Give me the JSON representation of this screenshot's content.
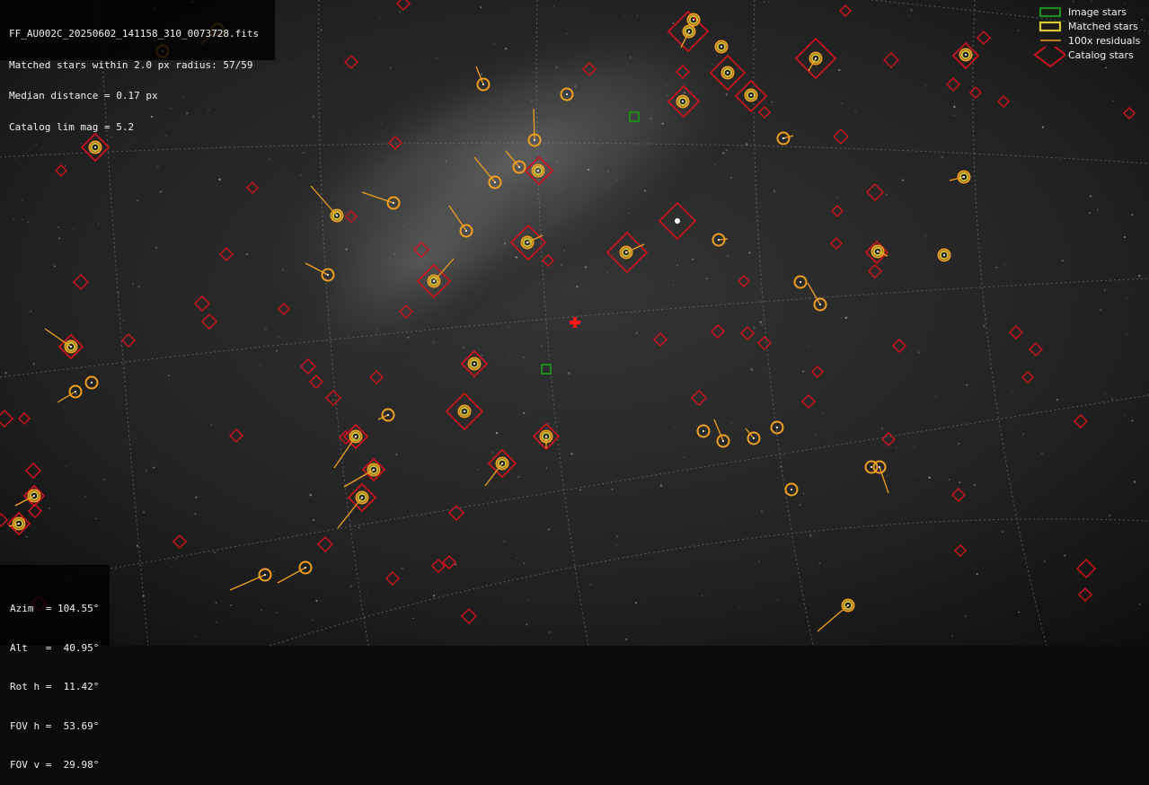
{
  "info": {
    "filename": "FF_AU002C_20250602_141158_310_0073728.fits",
    "matched": "Matched stars within 2.0 px radius: 57/59",
    "median": "Median distance = 0.17 px",
    "limmag": "Catalog lim mag = 5.2"
  },
  "orientation": {
    "azim": "Azim  = 104.55°",
    "alt": "Alt   =  40.95°",
    "roth": "Rot h =  11.42°",
    "fovh": "FOV h =  53.69°",
    "fovv": "FOV v =  29.98°"
  },
  "legend": {
    "image_stars": "Image stars",
    "matched_stars": "Matched stars",
    "residuals": "100x residuals",
    "catalog_stars": "Catalog stars"
  },
  "colors": {
    "image_star": "#1f8a1f",
    "matched_star": "#d8c836",
    "residual": "#f0a020",
    "catalog_star": "#c8141e",
    "center_marker": "#ff1a1a"
  },
  "icons": {
    "image_star": "green-square-icon",
    "matched_star": "yellow-circle-icon",
    "residual": "orange-line-icon",
    "catalog_star": "red-diamond-icon",
    "center": "red-cross-icon"
  }
}
